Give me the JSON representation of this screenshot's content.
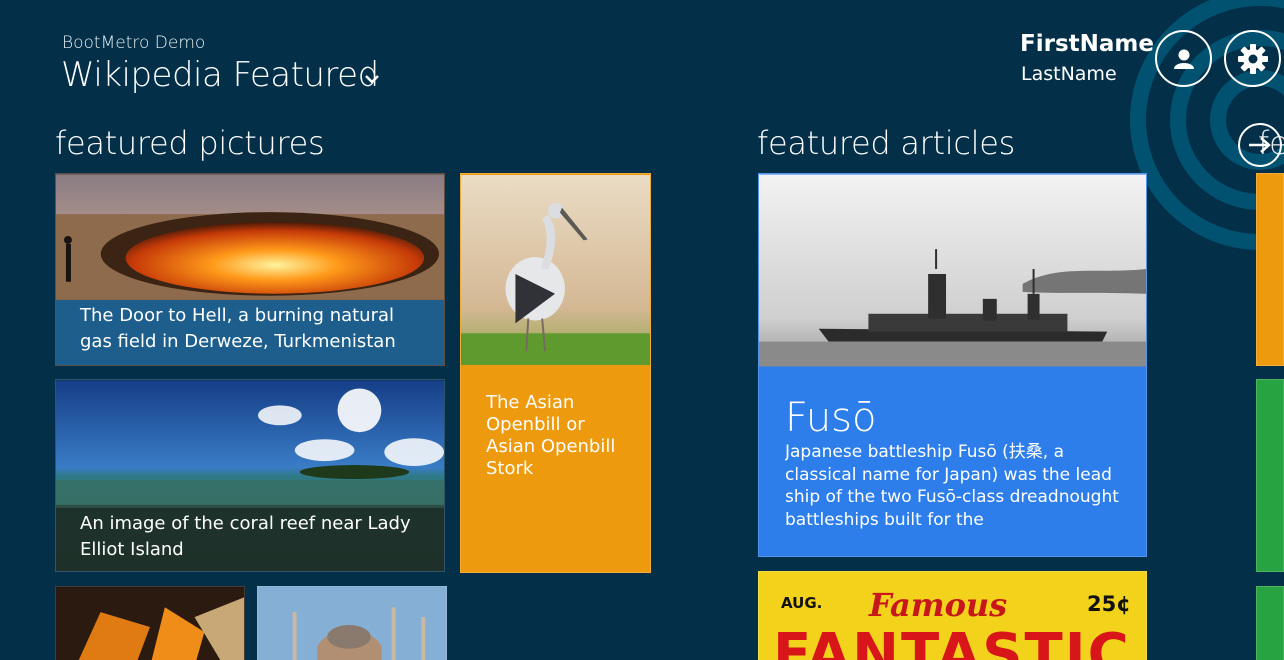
{
  "header": {
    "app_name": "BootMetro Demo",
    "page_title": "Wikipedia Featured"
  },
  "user": {
    "first_name": "FirstName",
    "last_name": "LastName"
  },
  "sections": {
    "pictures_title": "featured pictures",
    "articles_title": "featured articles",
    "third_title_partial": "fe"
  },
  "pictures": [
    {
      "caption": "The Door to Hell, a burning natural gas field in Derweze, Turkmenistan"
    },
    {
      "caption": "The Asian Openbill or Asian Openbill Stork"
    },
    {
      "caption": "An image of the coral reef near Lady Elliot Island"
    }
  ],
  "articles": [
    {
      "title": "Fusō",
      "summary": "Japanese battleship Fusō (扶桑, a classical name for Japan) was the lead ship of the two Fusō-class dreadnought battleships built for the"
    }
  ],
  "comic": {
    "aug": "AUG.",
    "famous": "Famous",
    "price": "25¢",
    "title": "FANTASTIC"
  },
  "colors": {
    "background": "#033048",
    "tile_blue": "#2d7eea",
    "tile_orange": "#ee9a0e",
    "tile_green": "#27a341",
    "caption_blue": "#1e5e8c"
  },
  "icons": {
    "user": "user-icon",
    "settings": "gear-icon",
    "chevron": "chevron-down-icon",
    "arrow": "arrow-right-icon"
  }
}
